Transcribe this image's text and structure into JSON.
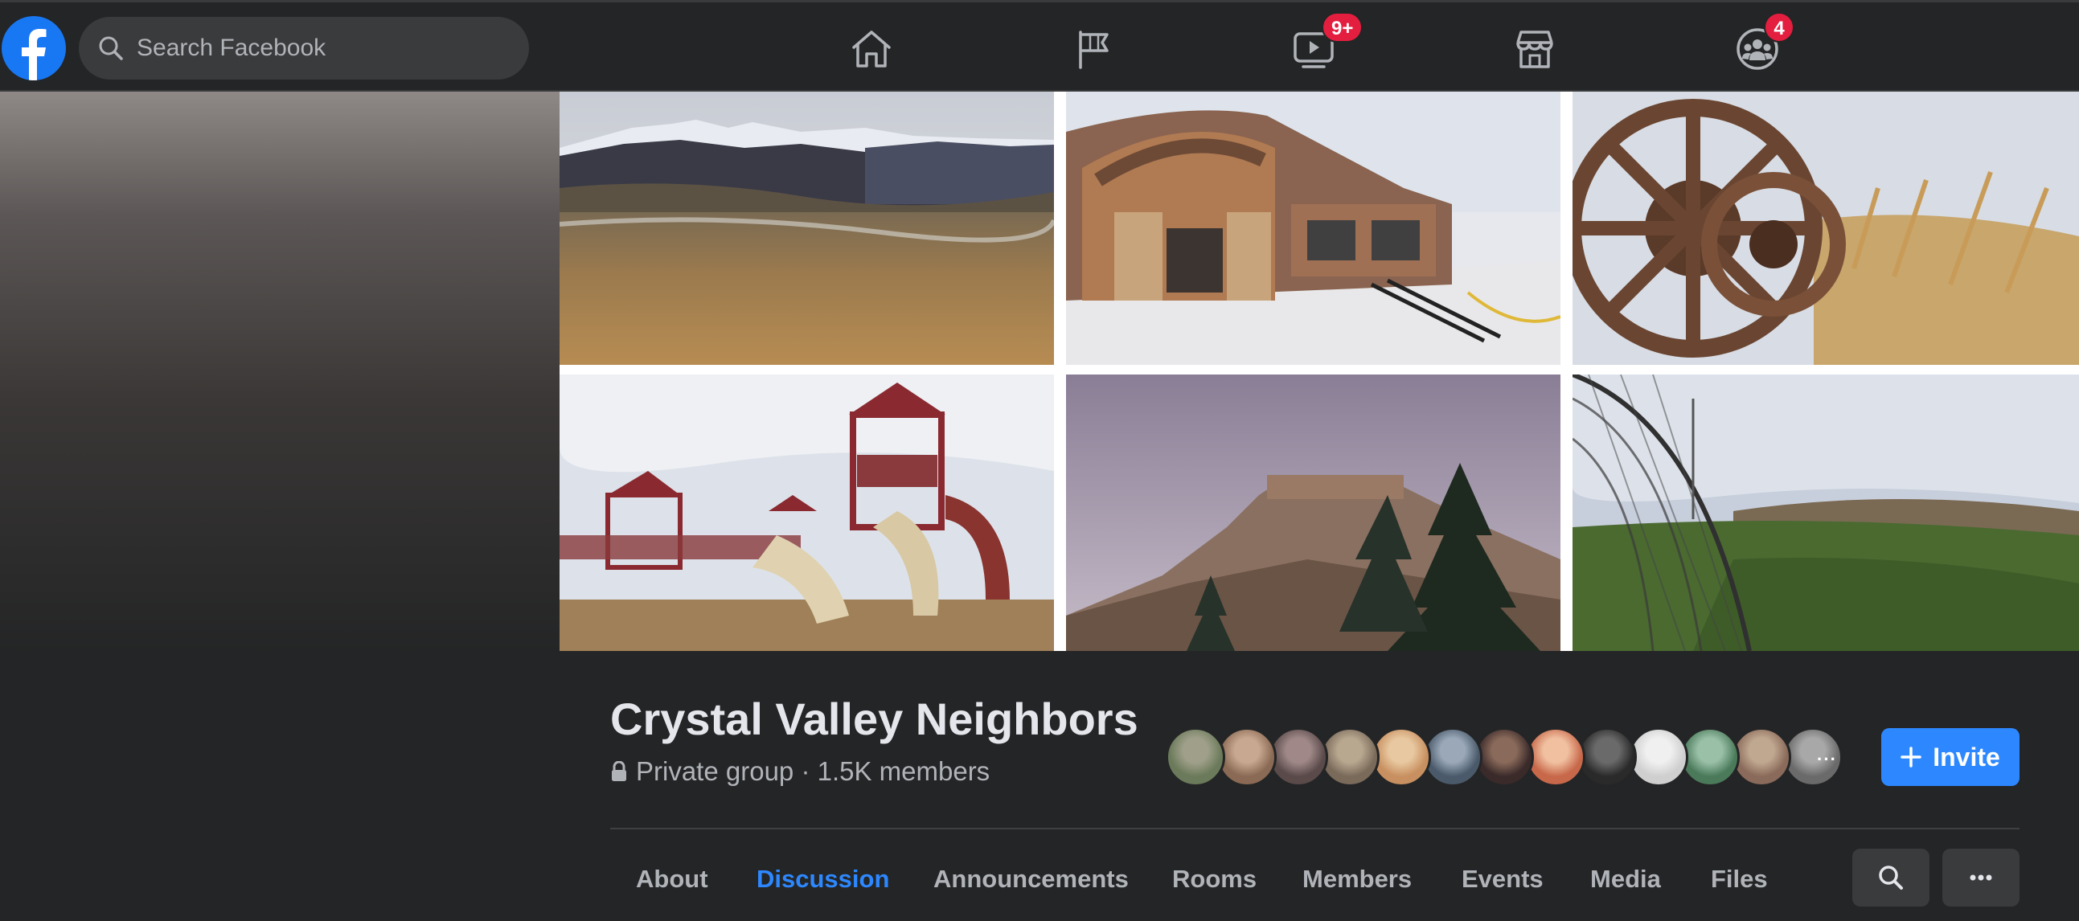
{
  "topbar": {
    "search_placeholder": "Search Facebook",
    "nav": [
      {
        "name": "home",
        "icon": "home-icon"
      },
      {
        "name": "pages",
        "icon": "flag-icon"
      },
      {
        "name": "watch",
        "icon": "video-play-icon",
        "badge": "9+"
      },
      {
        "name": "marketplace",
        "icon": "storefront-icon"
      },
      {
        "name": "groups",
        "icon": "groups-icon",
        "badge": "4"
      }
    ]
  },
  "cover": {
    "photos": [
      {
        "subject": "mountain-meadow-photo"
      },
      {
        "subject": "community-building-photo"
      },
      {
        "subject": "rusty-wheel-photo"
      },
      {
        "subject": "playground-photo"
      },
      {
        "subject": "rock-butte-photo"
      },
      {
        "subject": "sports-field-photo"
      }
    ]
  },
  "group": {
    "name": "Crystal Valley Neighbors",
    "meta": "Private group · 1.5K members",
    "member_avatar_count": 13,
    "more_indicator": "···",
    "invite_label": "Invite"
  },
  "tabs": [
    {
      "label": "About",
      "active": false
    },
    {
      "label": "Discussion",
      "active": true
    },
    {
      "label": "Announcements",
      "active": false
    },
    {
      "label": "Rooms",
      "active": false
    },
    {
      "label": "Members",
      "active": false
    },
    {
      "label": "Events",
      "active": false
    },
    {
      "label": "Media",
      "active": false
    },
    {
      "label": "Files",
      "active": false
    }
  ],
  "colors": {
    "background": "#242526",
    "accent": "#2d88ff",
    "badge": "#e41e3f",
    "text_primary": "#e4e6eb",
    "text_secondary": "#b0b3b8"
  }
}
